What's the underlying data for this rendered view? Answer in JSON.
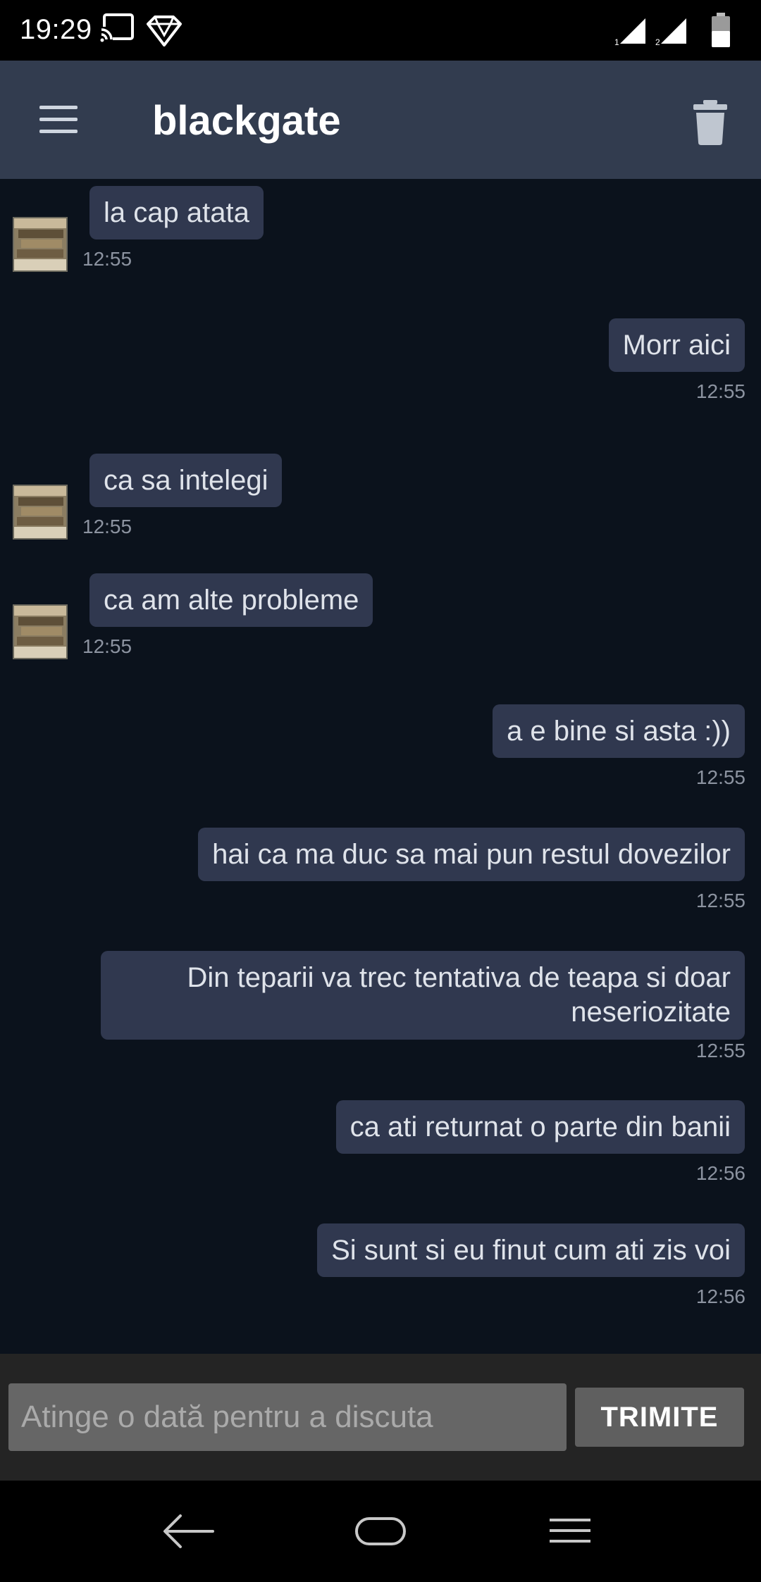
{
  "status_bar": {
    "time": "19:29",
    "icons": [
      "cast-icon",
      "vpn-icon",
      "signal-sim1-icon",
      "signal-sim2-icon",
      "battery-icon"
    ],
    "sim1_label": "1",
    "sim2_label": "2"
  },
  "app_bar": {
    "title": "blackgate",
    "menu_icon": "menu-icon",
    "delete_icon": "trash-icon"
  },
  "messages": [
    {
      "direction": "incoming",
      "text": "la cap atata",
      "time": "12:55"
    },
    {
      "direction": "outgoing",
      "text": "Morr aici",
      "time": "12:55"
    },
    {
      "direction": "incoming",
      "text": "ca sa intelegi",
      "time": "12:55"
    },
    {
      "direction": "incoming",
      "text": "ca am alte probleme",
      "time": "12:55"
    },
    {
      "direction": "outgoing",
      "text": "a e bine si asta :))",
      "time": "12:55"
    },
    {
      "direction": "outgoing",
      "text": "hai ca ma duc sa mai pun restul dovezilor",
      "time": "12:55"
    },
    {
      "direction": "outgoing",
      "text": "Din teparii va trec tentativa de teapa si doar neseriozitate",
      "time": "12:55"
    },
    {
      "direction": "outgoing",
      "text": "ca ati returnat o parte din banii",
      "time": "12:56"
    },
    {
      "direction": "outgoing",
      "text": "Si sunt si eu finut cum ati zis voi",
      "time": "12:56"
    }
  ],
  "composer": {
    "placeholder": "Atinge o dată pentru a discuta",
    "value": "",
    "send_label": "TRIMITE"
  },
  "nav_bar": {
    "icons": [
      "back-icon",
      "home-icon",
      "recents-icon"
    ]
  },
  "colors": {
    "app_bar": "#323c4f",
    "chat_background": "#0b121c",
    "bubble": "#30384f",
    "timestamp": "#8c93a0"
  }
}
